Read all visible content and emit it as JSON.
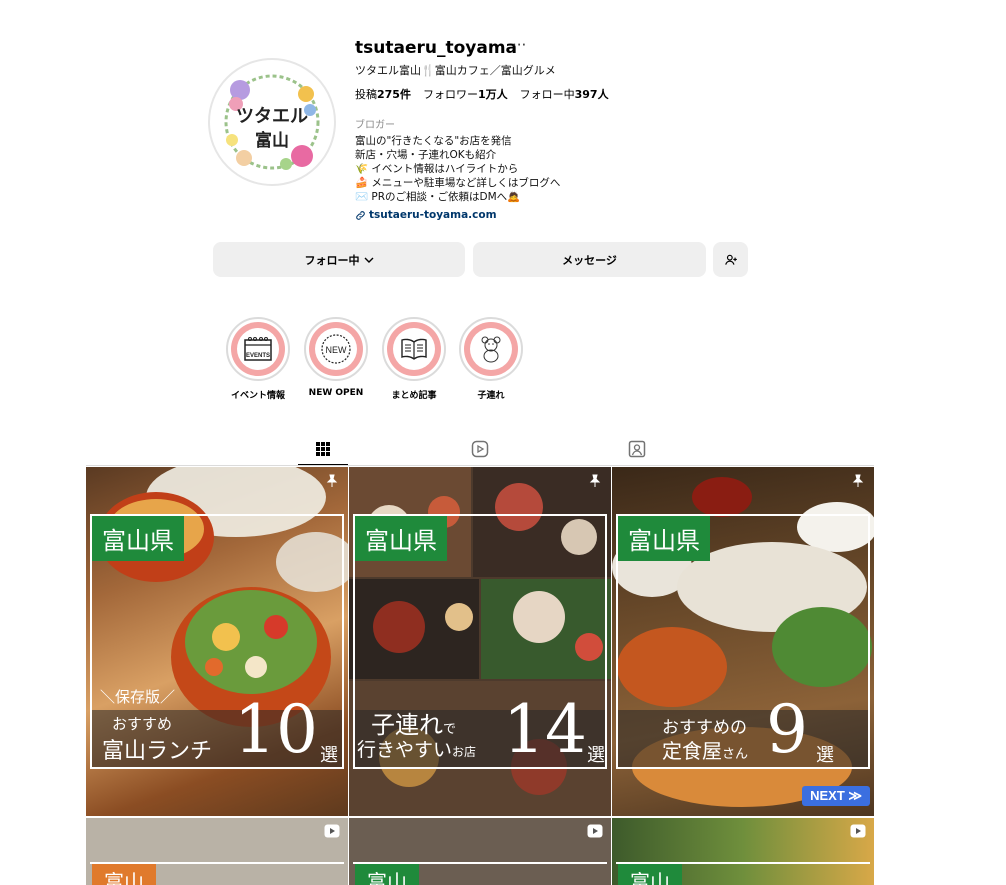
{
  "profile": {
    "username": "tsutaeru_toyama",
    "more": "···",
    "full_name": "ツタエル富山🍴富山カフェ／富山グルメ",
    "avatar_text_1": "ツタエル",
    "avatar_text_2": "富山",
    "stats": [
      {
        "prefix": "投稿",
        "value": "275件"
      },
      {
        "prefix": "フォロワー",
        "value": "1万人"
      },
      {
        "prefix": "フォロー中",
        "value": "397人"
      }
    ],
    "category": "ブロガー",
    "bio": [
      "富山の\"行きたくなる\"お店を発信",
      "新店・穴場・子連れOKも紹介",
      "🌾 イベント情報はハイライトから",
      "🍰 メニューや駐車場など詳しくはブログへ",
      "✉️ PRのご相談・ご依頼はDMへ🙇",
      "tsutaeru-toyama.com"
    ]
  },
  "buttons": {
    "follow": "フォロー中",
    "message": "メッセージ"
  },
  "highlights": [
    {
      "label": "イベント情報",
      "icon": "EVENTS"
    },
    {
      "label": "NEW OPEN",
      "icon": "NEW"
    },
    {
      "label": "まとめ記事",
      "icon": "book"
    },
    {
      "label": "子連れ",
      "icon": "bear"
    }
  ],
  "tabs": [
    "posts-grid",
    "reels",
    "tagged"
  ],
  "posts": [
    {
      "pref": "富山県",
      "sub": "＼保存版／",
      "line1": "おすすめ",
      "line2": "富山ランチ",
      "num": "10",
      "suffix": "選"
    },
    {
      "pref": "富山県",
      "line1a": "子連れ",
      "line1b": "で",
      "line2a": "行きやすい",
      "line2b": "お店",
      "num": "14",
      "suffix": "選"
    },
    {
      "pref": "富山県",
      "line1": "おすすめの",
      "line2a": "定食屋",
      "line2b": "さん",
      "num": "9",
      "suffix": "選",
      "next": "NEXT ≫"
    }
  ],
  "bottom_posts": [
    {
      "pref": "富山"
    },
    {
      "pref": "富山"
    },
    {
      "pref": "富山"
    }
  ]
}
